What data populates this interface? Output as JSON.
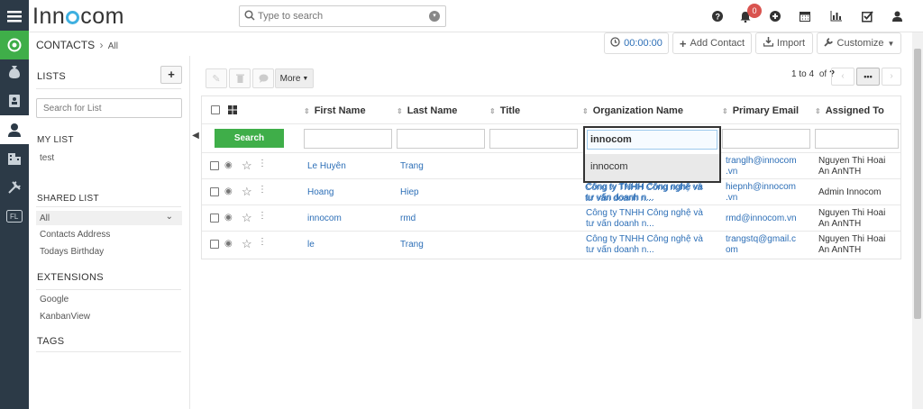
{
  "app": {
    "logo_prefix": "Inn",
    "logo_suffix": "com"
  },
  "topbar": {
    "search_placeholder": "Type to search",
    "notification_count": "0"
  },
  "header": {
    "module": "CONTACTS",
    "view": "All"
  },
  "actions": {
    "timer": "00:00:00",
    "add_contact": "Add Contact",
    "import": "Import",
    "customize": "Customize"
  },
  "sidebar": {
    "lists_title": "LISTS",
    "add_label": "+",
    "search_placeholder": "Search for List",
    "my_list_title": "MY LIST",
    "my_list_items": [
      "test"
    ],
    "shared_list_title": "SHARED LIST",
    "shared_list_items": [
      "All",
      "Contacts Address",
      "Todays Birthday"
    ],
    "extensions_title": "EXTENSIONS",
    "extensions_items": [
      "Google",
      "KanbanView"
    ],
    "tags_title": "TAGS"
  },
  "toolbar": {
    "more_label": "More"
  },
  "pagination": {
    "range": "1 to 4",
    "of": "of",
    "total": "?",
    "more": "•••"
  },
  "table": {
    "columns": [
      "First Name",
      "Last Name",
      "Title",
      "Organization Name",
      "Primary Email",
      "Assigned To"
    ],
    "search_button": "Search",
    "rows": [
      {
        "first": "Le Huyên",
        "last": "Trang",
        "title": "",
        "org": "Công ty TNHH Công nghệ và tư vấn doanh n...",
        "email": "tranglh@innocom.vn",
        "assigned": "Nguyen Thi Hoai An AnNTH"
      },
      {
        "first": "Hoang",
        "last": "Hiep",
        "title": "",
        "org": "Công ty TNHH Công nghệ và tư vấn doanh n...",
        "email": "hiepnh@innocom.vn",
        "assigned": "Admin Innocom"
      },
      {
        "first": "innocom",
        "last": "rmd",
        "title": "",
        "org": "Công ty TNHH Công nghệ và tư vấn doanh n...",
        "email": "rmd@innocom.vn",
        "assigned": "Nguyen Thi Hoai An AnNTH"
      },
      {
        "first": "le",
        "last": "Trang",
        "title": "",
        "org": "Công ty TNHH Công nghệ và tư vấn doanh n...",
        "email": "trangstq@gmail.com",
        "assigned": "Nguyen Thi Hoai An AnNTH"
      }
    ],
    "email_display": [
      [
        "tranglh@innocom",
        ".vn"
      ],
      [
        "hiepnh@innocom",
        ".vn"
      ],
      [
        "rmd@innocom.vn",
        ""
      ],
      [
        "trangstq@gmail.c",
        "om"
      ]
    ],
    "assigned_display": [
      [
        "Nguyen Thi Hoai",
        "An AnNTH"
      ],
      [
        "Admin Innocom",
        ""
      ],
      [
        "Nguyen Thi Hoai",
        "An AnNTH"
      ],
      [
        "Nguyen Thi Hoai",
        "An AnNTH"
      ]
    ],
    "org_display": [
      "Công ty TNHH Công nghệ và",
      "tư vấn doanh n..."
    ]
  },
  "autocomplete": {
    "input_value": "innocom",
    "suggestion": "innocom"
  },
  "colors": {
    "accent_green": "#3fae49",
    "link_blue": "#2d6fb7",
    "rail_dark": "#2c3a47",
    "badge_red": "#d9534f"
  }
}
